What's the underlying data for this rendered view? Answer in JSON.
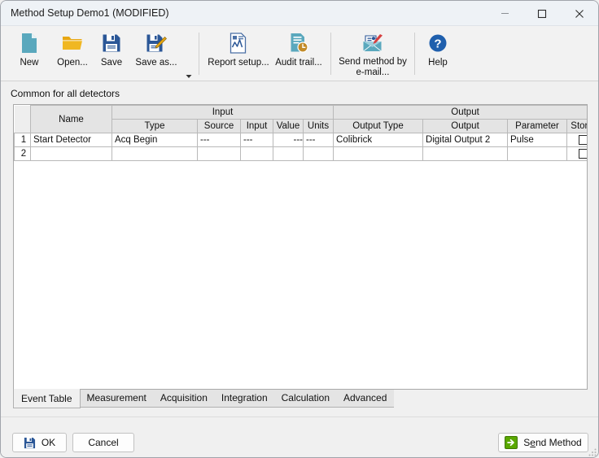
{
  "window": {
    "title": "Method Setup Demo1 (MODIFIED)",
    "controls": {
      "minimize": "minimize-icon",
      "maximize": "maximize-icon",
      "close": "close-icon"
    }
  },
  "toolbar": {
    "buttons": [
      {
        "label": "New",
        "icon": "new-document-icon"
      },
      {
        "label": "Open...",
        "icon": "open-folder-icon"
      },
      {
        "label": "Save",
        "icon": "floppy-disk-icon"
      },
      {
        "label": "Save as...",
        "icon": "save-as-icon"
      },
      {
        "label": "Report setup...",
        "icon": "report-setup-icon"
      },
      {
        "label": "Audit trail...",
        "icon": "audit-trail-icon"
      },
      {
        "label": "Send method by\ne-mail...",
        "icon": "send-email-icon"
      },
      {
        "label": "Help",
        "icon": "help-question-icon"
      }
    ],
    "dropdown_arrow": "chevron-down-icon"
  },
  "content": {
    "section_label": "Common for all detectors"
  },
  "table": {
    "group_headers": [
      {
        "label": "",
        "span": "rownum"
      },
      {
        "label": "Name",
        "span": "name"
      },
      {
        "label": "Input",
        "span": "input"
      },
      {
        "label": "Output",
        "span": "output"
      }
    ],
    "group_input": "Input",
    "group_output": "Output",
    "columns": [
      "Name",
      "Type",
      "Source",
      "Input",
      "Value",
      "Units",
      "Output Type",
      "Output",
      "Parameter",
      "Store"
    ],
    "rows": [
      {
        "num": "1",
        "name": "Start Detector",
        "type": "Acq Begin",
        "source": "---",
        "input": "---",
        "value": "---",
        "units": "---",
        "output_type": "Colibrick",
        "output": "Digital Output 2",
        "parameter": "Pulse",
        "store": false
      },
      {
        "num": "2",
        "name": "",
        "type": "",
        "source": "",
        "input": "",
        "value": "",
        "units": "",
        "output_type": "",
        "output": "",
        "parameter": "",
        "store": false
      }
    ]
  },
  "tabs": {
    "active": "Event Table",
    "items": [
      "Event Table",
      "Measurement",
      "Acquisition",
      "Integration",
      "Calculation",
      "Advanced"
    ]
  },
  "bottom": {
    "ok_label": "OK",
    "ok_icon": "floppy-disk-icon",
    "cancel_label": "Cancel",
    "send_method_prefix": "S",
    "send_method_accel": "e",
    "send_method_suffix": "nd Method",
    "send_method_icon": "green-arrow-icon"
  },
  "colors": {
    "titlebar": "#eef2f6",
    "toolbar": "#f2f2f2",
    "window_bg": "#f0f0f0",
    "header_cell": "#e4e4e4",
    "accent_blue": "#2b5797",
    "accent_teal": "#5aa8bd",
    "accent_gold": "#e8a712",
    "accent_green": "#5aa800"
  }
}
